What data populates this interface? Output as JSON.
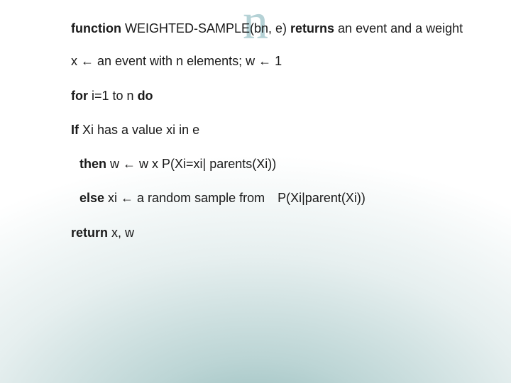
{
  "watermark": "n",
  "sig": {
    "kw_function": "function",
    "name": " WEIGHTED-SAMPLE(bn, e) ",
    "kw_returns": "returns",
    "tail": " an event and a weight"
  },
  "line_init": "x ← an event with n elements; w ← 1",
  "loop": {
    "kw_for": "for",
    "mid": " i=1 to n ",
    "kw_do": "do"
  },
  "if_line": {
    "kw_if": "If",
    "rest": " Xi has a value xi in e"
  },
  "then_line": {
    "kw_then": "then",
    "rest": " w ← w x P(Xi=xi| parents(Xi))"
  },
  "else_line": {
    "kw_else": "else",
    "mid": " xi ← a random sample from",
    "tail": "P(Xi|parent(Xi))"
  },
  "return_line": {
    "kw_return": "return",
    "rest": " x, w"
  }
}
